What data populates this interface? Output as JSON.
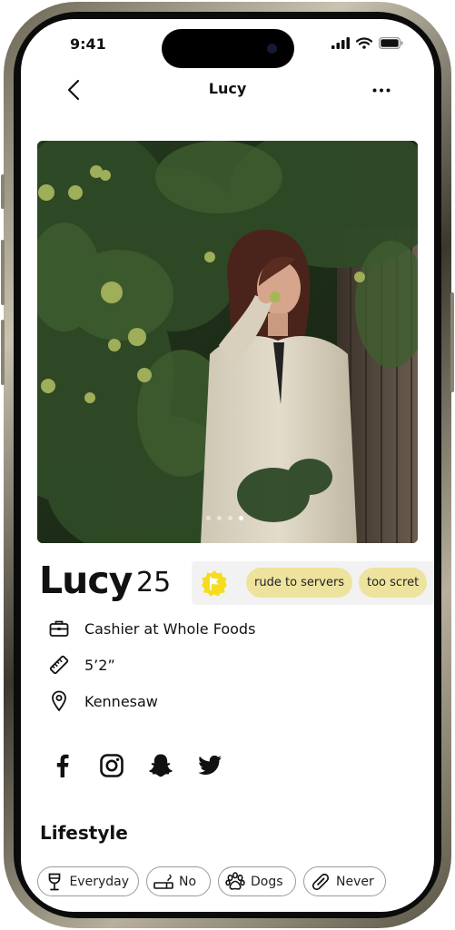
{
  "status_bar": {
    "time": "9:41"
  },
  "nav": {
    "title": "Lucy"
  },
  "profile": {
    "name": "Lucy",
    "age": "25"
  },
  "red_flags": [
    "rude to servers",
    "too scret"
  ],
  "details": {
    "job": "Cashier at Whole Foods",
    "height": "5’2”",
    "location": "Kennesaw"
  },
  "photo": {
    "page_count": 4,
    "active_index": 3
  },
  "socials": [
    "facebook-icon",
    "instagram-icon",
    "snapchat-icon",
    "twitter-icon"
  ],
  "lifestyle": {
    "title": "Lifestyle",
    "items": [
      {
        "icon": "wine-glass-icon",
        "label": "Everyday"
      },
      {
        "icon": "cigarette-icon",
        "label": "No"
      },
      {
        "icon": "paw-icon",
        "label": "Dogs"
      },
      {
        "icon": "pill-icon",
        "label": "Never"
      }
    ]
  },
  "colors": {
    "flag_pill": "#ede39e",
    "flag_icon": "#f6dc1f",
    "flags_bg": "#f2f2f2"
  }
}
